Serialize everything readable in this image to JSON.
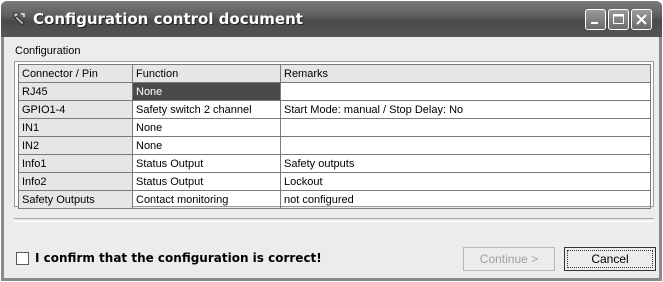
{
  "window": {
    "title": "Configuration control document",
    "controls": [
      "minimize-icon",
      "maximize-icon",
      "close-icon"
    ]
  },
  "group_label": "Configuration",
  "table": {
    "columns": [
      "Connector / Pin",
      "Function",
      "Remarks"
    ],
    "rows": [
      {
        "connector": "RJ45",
        "function": "None",
        "remarks": "",
        "selected": true
      },
      {
        "connector": "GPIO1-4",
        "function": "Safety switch 2 channel",
        "remarks": "Start Mode: manual / Stop Delay: No"
      },
      {
        "connector": "IN1",
        "function": "None",
        "remarks": ""
      },
      {
        "connector": "IN2",
        "function": "None",
        "remarks": ""
      },
      {
        "connector": "Info1",
        "function": "Status Output",
        "remarks": "Safety outputs"
      },
      {
        "connector": "Info2",
        "function": "Status Output",
        "remarks": "Lockout"
      },
      {
        "connector": "Safety Outputs",
        "function": "Contact monitoring",
        "remarks": "not configured"
      }
    ]
  },
  "confirm": {
    "label": "I confirm that the configuration is correct!",
    "checked": false
  },
  "buttons": {
    "continue_label": "Continue >",
    "continue_enabled": false,
    "cancel_label": "Cancel"
  }
}
